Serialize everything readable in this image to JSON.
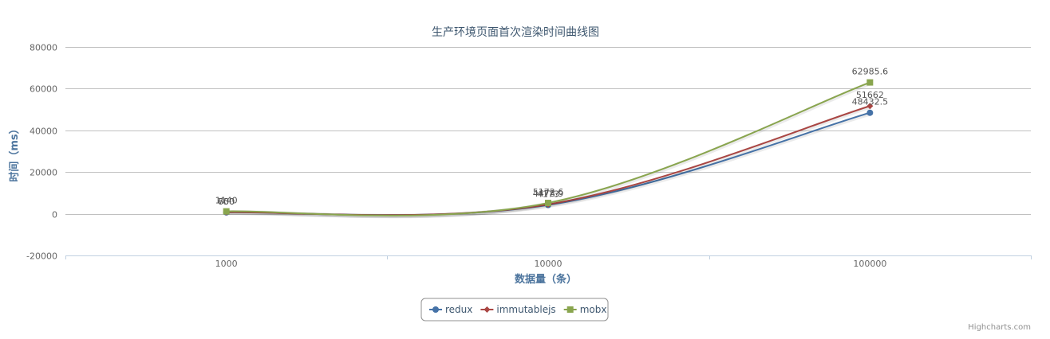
{
  "chart_data": {
    "type": "line",
    "title": "生产环境页面首次渲染时间曲线图",
    "xlabel": "数据量（条）",
    "ylabel": "时间（ms）",
    "categories": [
      "1000",
      "10000",
      "100000"
    ],
    "ylim": [
      -20000,
      80000
    ],
    "yticks": [
      -20000,
      0,
      20000,
      40000,
      60000,
      80000
    ],
    "grid": true,
    "legend_position": "bottom-center",
    "series": [
      {
        "name": "redux",
        "values": [
          650,
          4173,
          48432.5
        ],
        "labels": [
          "650",
          "4173",
          "48432.5"
        ],
        "color": "#4572A7",
        "marker": "circle"
      },
      {
        "name": "immutablejs",
        "values": [
          700,
          4478.9,
          51662
        ],
        "labels": [
          "700",
          "4478.9",
          "51662"
        ],
        "color": "#AA4643",
        "marker": "diamond"
      },
      {
        "name": "mobx",
        "values": [
          1140,
          5172.6,
          62985.6
        ],
        "labels": [
          "1140",
          "5172.6",
          "62985.6"
        ],
        "color": "#89A54E",
        "marker": "square"
      }
    ]
  },
  "credits": "Highcharts.com"
}
